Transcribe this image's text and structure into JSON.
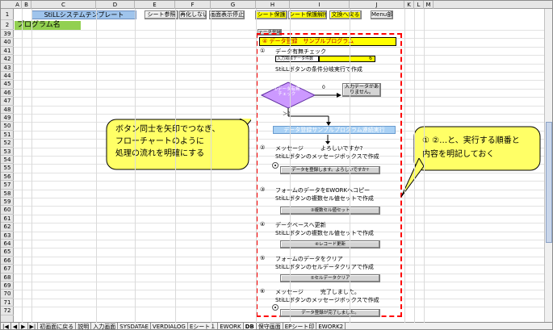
{
  "columns": [
    "A",
    "B",
    "C",
    "D",
    "E",
    "F",
    "G",
    "H",
    "I",
    "J",
    "K",
    "L",
    "M"
  ],
  "rows": [
    "1",
    "2",
    "39",
    "40",
    "41",
    "42",
    "43",
    "44",
    "45",
    "46",
    "47",
    "48",
    "49",
    "50",
    "51",
    "52",
    "53",
    "54",
    "55",
    "56",
    "57",
    "58",
    "59",
    "60",
    "61",
    "62",
    "63",
    "64",
    "65",
    "66",
    "67",
    "68",
    "69",
    "70",
    "71",
    "72"
  ],
  "toolbar": {
    "system_title": "StiLLシステムテンプレート",
    "sheet_ref": "シート参照",
    "show_hide": "再化しない",
    "screen_stop": "画面表示停止",
    "sheet_protect": "シート保護",
    "sheet_unprotect": "シート保護解除",
    "text_to_value": "文換へ戻る",
    "menu": "Menu部"
  },
  "program_name": "プログラム名",
  "flow": {
    "header": "④ データ登録　サンプルプログラム",
    "step1_num": "①",
    "step1_title": "データ有無チェック",
    "step1_input_label": "入力項目データ件数",
    "step1_input_value": "6",
    "step1_desc": "StiLLボタンの条件分岐実行で作成",
    "diamond_label": "①データ有無\nチェック",
    "diamond_zero": "0",
    "nodata_button": "入力データがあ\nりません。",
    "gt0_label": "＞0",
    "bar_label": "データ登録サンプルプログラム連続実行",
    "step2_num": "②",
    "step2_title": "メッセージ　　　よろしいですか?",
    "step2_desc": "StiLLボタンのメッセージボックスで作成",
    "step2_button": "データを登録します。よろしいですか?",
    "step3_num": "③",
    "step3_title": "フォームのデータをEWORKへコピー",
    "step3_desc": "StiLLボタンの複数セル値セットで作成",
    "step3_button": "③複数セル値セット",
    "step4_num": "④",
    "step4_title": "データベースへ更新",
    "step4_desc": "StiLLボタンの複数セル値セットで作成",
    "step4_button": "④レコード更新",
    "step5_num": "⑤",
    "step5_title": "フォームのデータをクリア",
    "step5_desc": "StiLLボタンのセルデータクリアで作成",
    "step5_button": "⑤セルデータクリア",
    "step6_num": "⑥",
    "step6_title": "メッセージ　　　完了しました。",
    "step6_desc": "StiLLボタンのメッセージボックスで作成",
    "step6_button": "データ登録が完了しました。",
    "top_tag": "データ登録"
  },
  "callouts": {
    "left": "ボタン同士を矢印でつなぎ、\nフローチャートのように\n処理の流れを明確にする",
    "right": "① ②…と、実行する順番と\n内容を明記しておく"
  },
  "tabs": [
    "|◀",
    "◀",
    "▶",
    "▶|",
    "初画面に戻る",
    "説明",
    "入力画面",
    "SYSDATAE",
    "VERDIALOG",
    "Eシート１",
    "EWORK",
    "DB",
    "保守画面",
    "EPシート印",
    "EWORK2"
  ],
  "colors": {
    "accent_yellow": "#ffff00",
    "title_blue": "#9fc4ec",
    "program_green": "#92d050",
    "dash_red": "#ff0000",
    "callout_yellow": "#ffff66",
    "diamond": "#cc99ff",
    "bar_blue": "#a9d1f5"
  }
}
